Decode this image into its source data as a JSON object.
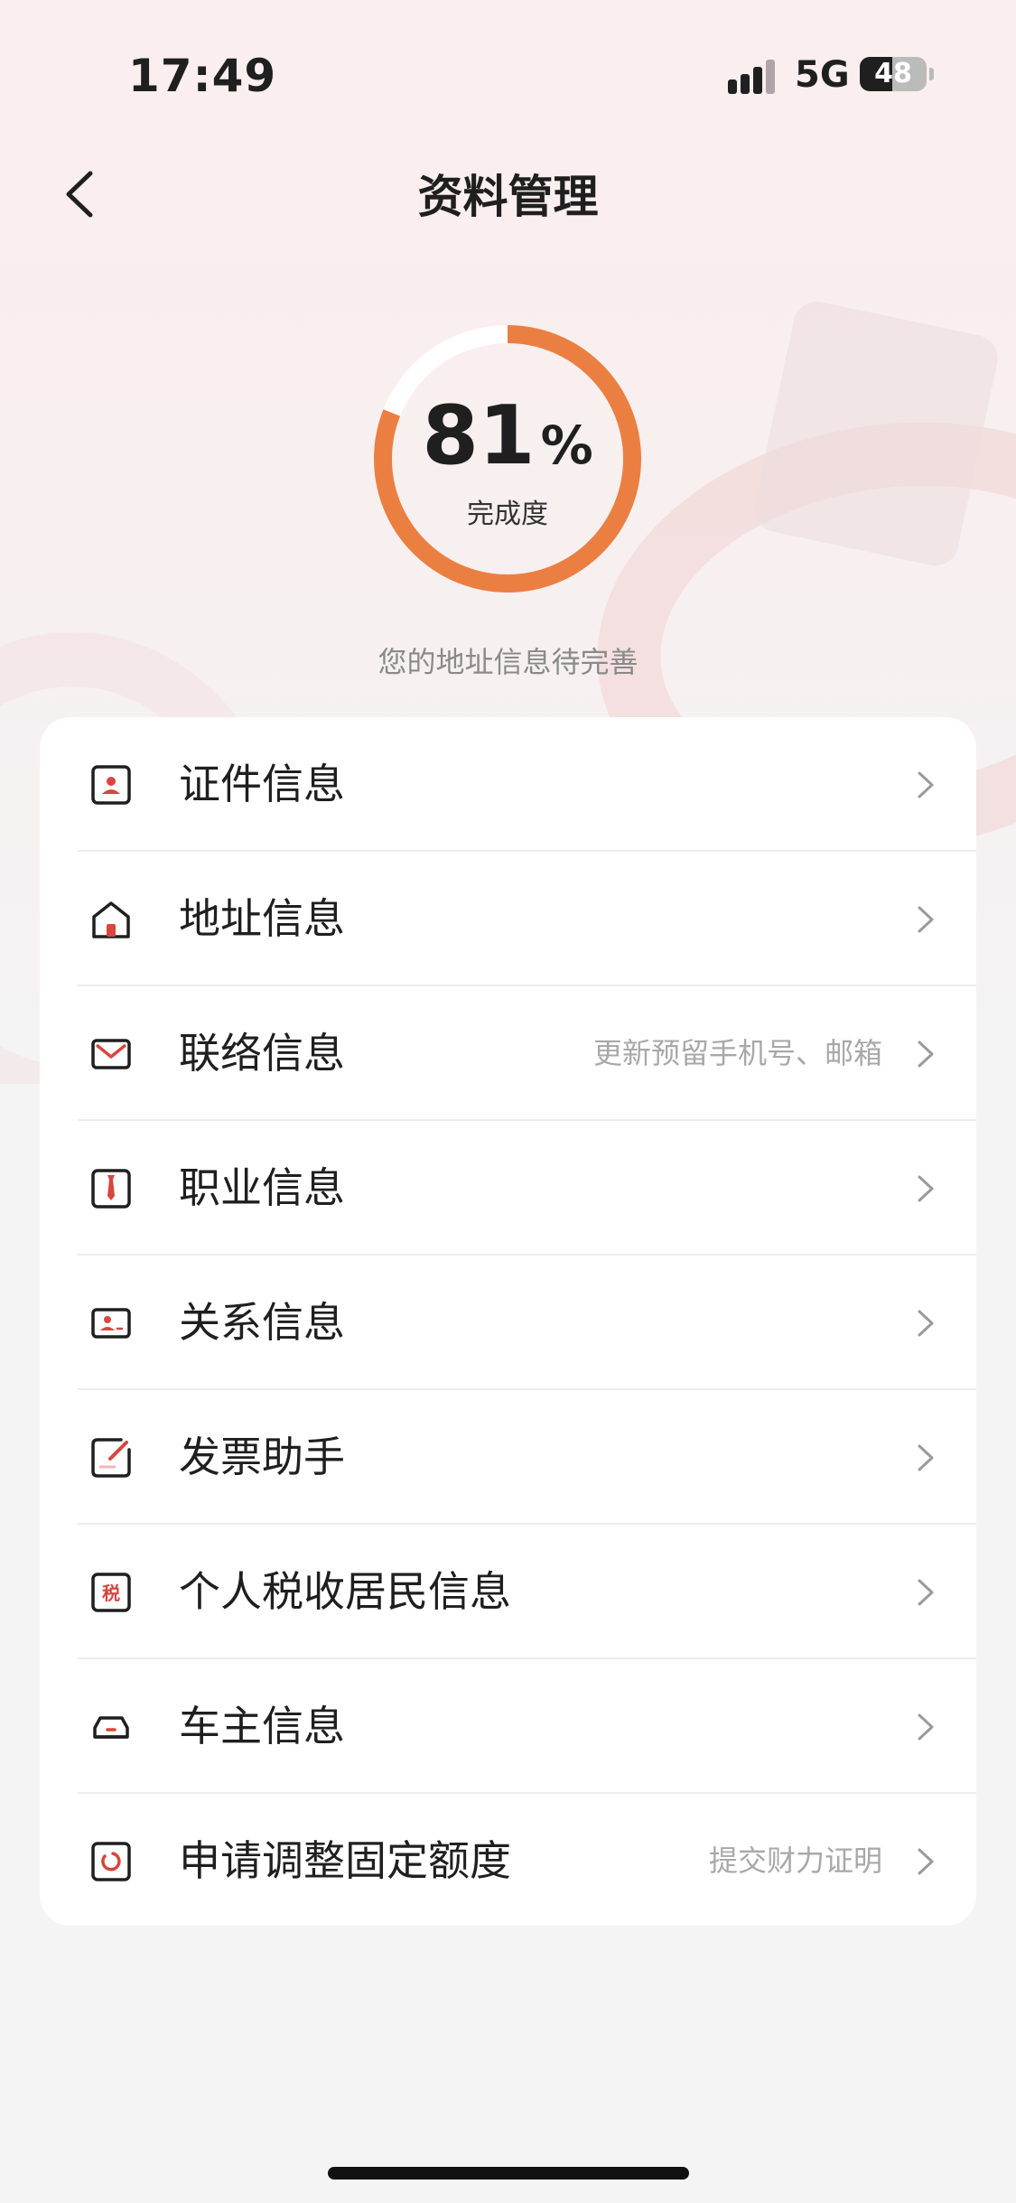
{
  "status": {
    "time": "17:49",
    "network": "5G",
    "battery": "48",
    "battery_level_percent": 48
  },
  "nav": {
    "title": "资料管理"
  },
  "progress": {
    "value": "81",
    "value_number": 81,
    "unit": "%",
    "label": "完成度",
    "hint": "您的地址信息待完善"
  },
  "colors": {
    "accent": "#eb7f42",
    "icon_red": "#d9453f",
    "track": "#ffffff"
  },
  "items": [
    {
      "label": "证件信息",
      "sub": "",
      "icon": "id-card-icon"
    },
    {
      "label": "地址信息",
      "sub": "",
      "icon": "house-icon"
    },
    {
      "label": "联络信息",
      "sub": "更新预留手机号、邮箱",
      "icon": "envelope-icon"
    },
    {
      "label": "职业信息",
      "sub": "",
      "icon": "tie-icon"
    },
    {
      "label": "关系信息",
      "sub": "",
      "icon": "contact-card-icon"
    },
    {
      "label": "发票助手",
      "sub": "",
      "icon": "invoice-icon"
    },
    {
      "label": "个人税收居民信息",
      "sub": "",
      "icon": "tax-icon",
      "icon_text": "税"
    },
    {
      "label": "车主信息",
      "sub": "",
      "icon": "car-icon"
    },
    {
      "label": "申请调整固定额度",
      "sub": "提交财力证明",
      "icon": "refresh-circle-icon"
    }
  ]
}
